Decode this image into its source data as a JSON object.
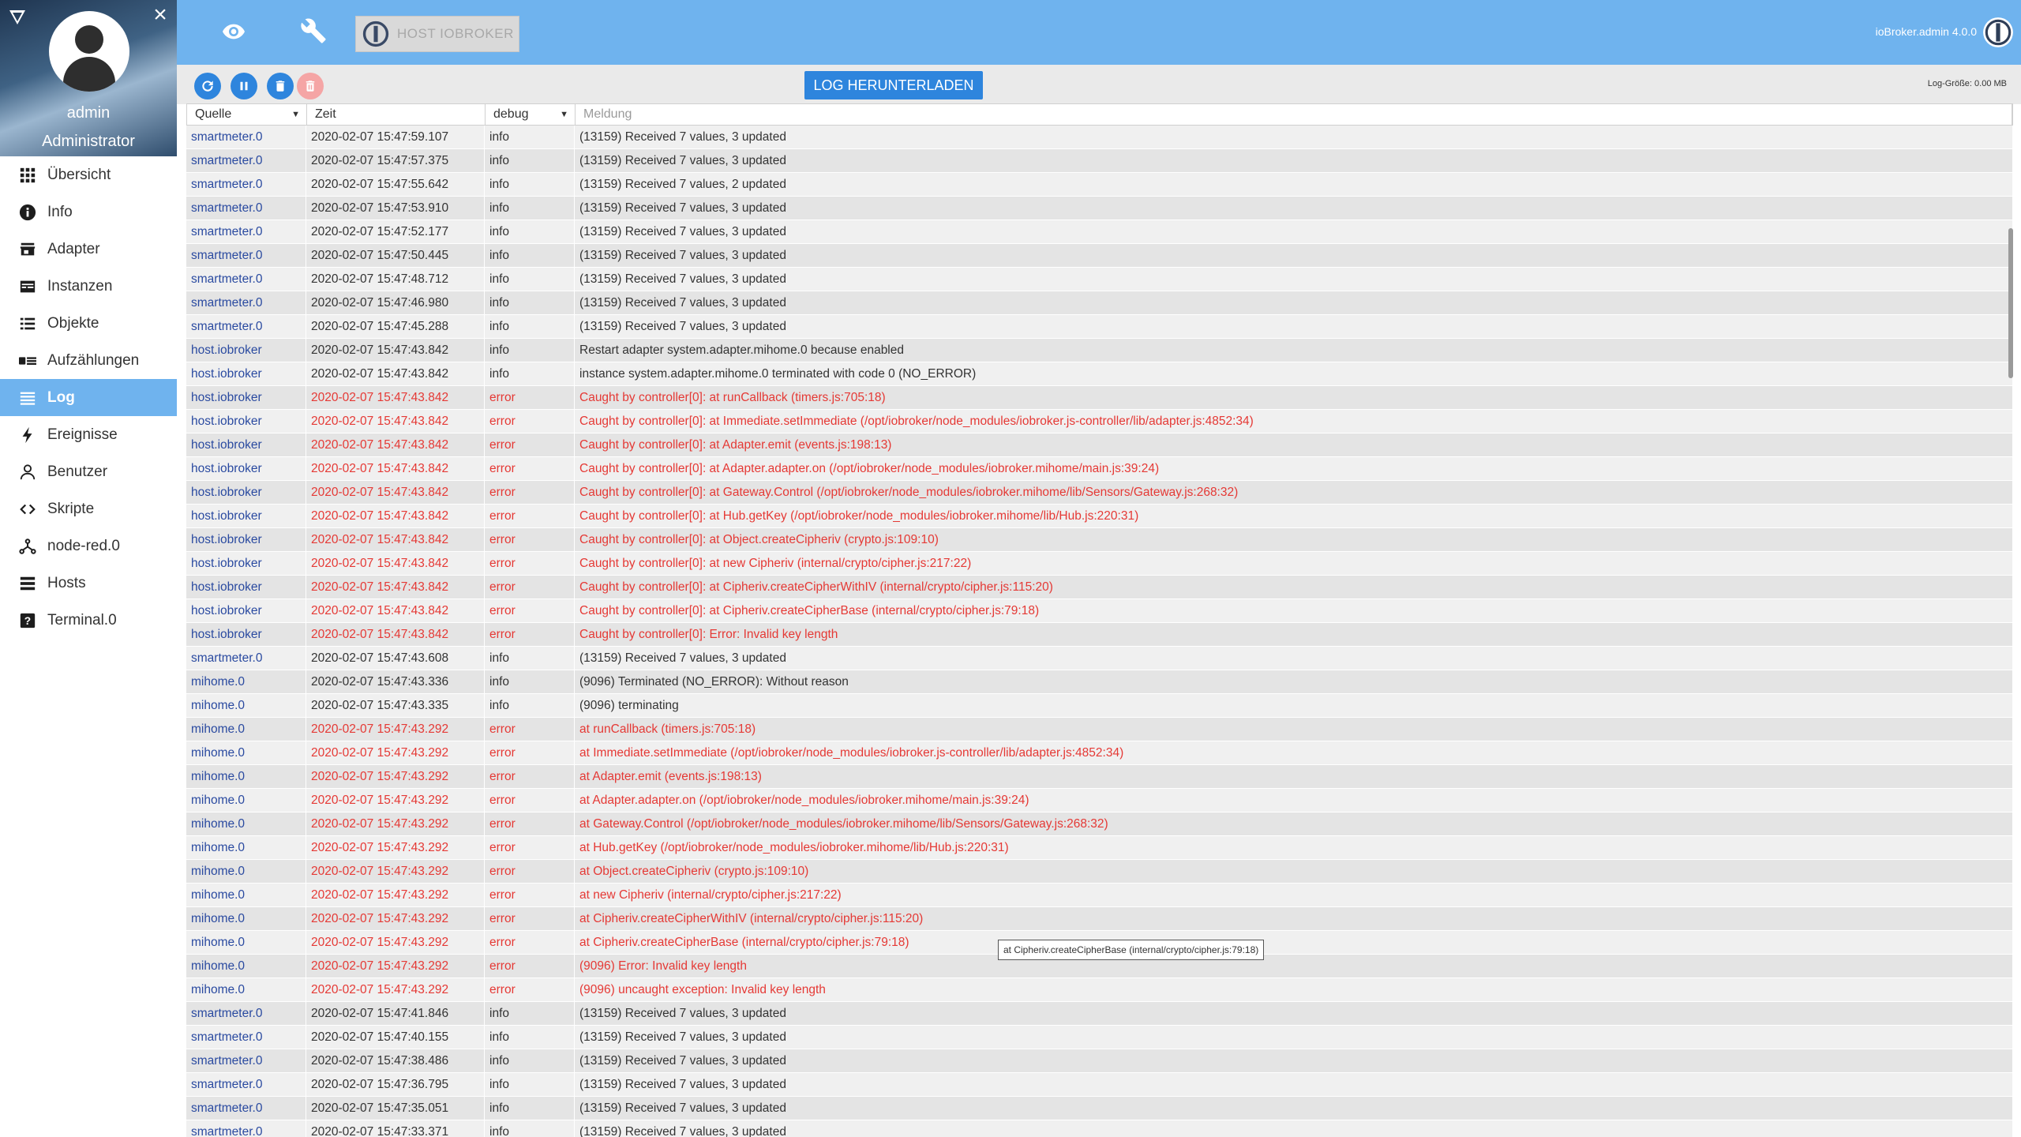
{
  "user": {
    "name": "admin",
    "role": "Administrator"
  },
  "nav": [
    {
      "label": "Übersicht",
      "icon": "grid-icon"
    },
    {
      "label": "Info",
      "icon": "info-icon"
    },
    {
      "label": "Adapter",
      "icon": "store-icon"
    },
    {
      "label": "Instanzen",
      "icon": "instances-icon"
    },
    {
      "label": "Objekte",
      "icon": "list-icon"
    },
    {
      "label": "Aufzählungen",
      "icon": "enum-icon"
    },
    {
      "label": "Log",
      "icon": "log-icon",
      "active": true
    },
    {
      "label": "Ereignisse",
      "icon": "lightning-icon"
    },
    {
      "label": "Benutzer",
      "icon": "user-icon"
    },
    {
      "label": "Skripte",
      "icon": "code-icon"
    },
    {
      "label": "node-red.0",
      "icon": "node-red-icon"
    },
    {
      "label": "Hosts",
      "icon": "hosts-icon"
    },
    {
      "label": "Terminal.0",
      "icon": "terminal-icon"
    }
  ],
  "topbar": {
    "host_tab": "HOST IOBROKER",
    "version": "ioBroker.admin 4.0.0"
  },
  "toolbar": {
    "download": "LOG HERUNTERLADEN",
    "log_size": "Log-Größe: 0.00 MB"
  },
  "table": {
    "headers": {
      "source": "Quelle",
      "time": "Zeit",
      "severity": "debug",
      "message_placeholder": "Meldung"
    },
    "rows": [
      {
        "src": "smartmeter.0",
        "time": "2020-02-07 15:47:59.107",
        "sev": "info",
        "msg": "(13159) Received 7 values, 3 updated"
      },
      {
        "src": "smartmeter.0",
        "time": "2020-02-07 15:47:57.375",
        "sev": "info",
        "msg": "(13159) Received 7 values, 3 updated"
      },
      {
        "src": "smartmeter.0",
        "time": "2020-02-07 15:47:55.642",
        "sev": "info",
        "msg": "(13159) Received 7 values, 2 updated"
      },
      {
        "src": "smartmeter.0",
        "time": "2020-02-07 15:47:53.910",
        "sev": "info",
        "msg": "(13159) Received 7 values, 3 updated"
      },
      {
        "src": "smartmeter.0",
        "time": "2020-02-07 15:47:52.177",
        "sev": "info",
        "msg": "(13159) Received 7 values, 3 updated"
      },
      {
        "src": "smartmeter.0",
        "time": "2020-02-07 15:47:50.445",
        "sev": "info",
        "msg": "(13159) Received 7 values, 3 updated"
      },
      {
        "src": "smartmeter.0",
        "time": "2020-02-07 15:47:48.712",
        "sev": "info",
        "msg": "(13159) Received 7 values, 3 updated"
      },
      {
        "src": "smartmeter.0",
        "time": "2020-02-07 15:47:46.980",
        "sev": "info",
        "msg": "(13159) Received 7 values, 3 updated"
      },
      {
        "src": "smartmeter.0",
        "time": "2020-02-07 15:47:45.288",
        "sev": "info",
        "msg": "(13159) Received 7 values, 3 updated"
      },
      {
        "src": "host.iobroker",
        "time": "2020-02-07 15:47:43.842",
        "sev": "info",
        "msg": "Restart adapter system.adapter.mihome.0 because enabled"
      },
      {
        "src": "host.iobroker",
        "time": "2020-02-07 15:47:43.842",
        "sev": "info",
        "msg": "instance system.adapter.mihome.0 terminated with code 0 (NO_ERROR)"
      },
      {
        "src": "host.iobroker",
        "time": "2020-02-07 15:47:43.842",
        "sev": "error",
        "msg": "Caught by controller[0]: at runCallback (timers.js:705:18)"
      },
      {
        "src": "host.iobroker",
        "time": "2020-02-07 15:47:43.842",
        "sev": "error",
        "msg": "Caught by controller[0]: at Immediate.setImmediate (/opt/iobroker/node_modules/iobroker.js-controller/lib/adapter.js:4852:34)"
      },
      {
        "src": "host.iobroker",
        "time": "2020-02-07 15:47:43.842",
        "sev": "error",
        "msg": "Caught by controller[0]: at Adapter.emit (events.js:198:13)"
      },
      {
        "src": "host.iobroker",
        "time": "2020-02-07 15:47:43.842",
        "sev": "error",
        "msg": "Caught by controller[0]: at Adapter.adapter.on (/opt/iobroker/node_modules/iobroker.mihome/main.js:39:24)"
      },
      {
        "src": "host.iobroker",
        "time": "2020-02-07 15:47:43.842",
        "sev": "error",
        "msg": "Caught by controller[0]: at Gateway.Control (/opt/iobroker/node_modules/iobroker.mihome/lib/Sensors/Gateway.js:268:32)"
      },
      {
        "src": "host.iobroker",
        "time": "2020-02-07 15:47:43.842",
        "sev": "error",
        "msg": "Caught by controller[0]: at Hub.getKey (/opt/iobroker/node_modules/iobroker.mihome/lib/Hub.js:220:31)"
      },
      {
        "src": "host.iobroker",
        "time": "2020-02-07 15:47:43.842",
        "sev": "error",
        "msg": "Caught by controller[0]: at Object.createCipheriv (crypto.js:109:10)"
      },
      {
        "src": "host.iobroker",
        "time": "2020-02-07 15:47:43.842",
        "sev": "error",
        "msg": "Caught by controller[0]: at new Cipheriv (internal/crypto/cipher.js:217:22)"
      },
      {
        "src": "host.iobroker",
        "time": "2020-02-07 15:47:43.842",
        "sev": "error",
        "msg": "Caught by controller[0]: at Cipheriv.createCipherWithIV (internal/crypto/cipher.js:115:20)"
      },
      {
        "src": "host.iobroker",
        "time": "2020-02-07 15:47:43.842",
        "sev": "error",
        "msg": "Caught by controller[0]: at Cipheriv.createCipherBase (internal/crypto/cipher.js:79:18)"
      },
      {
        "src": "host.iobroker",
        "time": "2020-02-07 15:47:43.842",
        "sev": "error",
        "msg": "Caught by controller[0]: Error: Invalid key length"
      },
      {
        "src": "smartmeter.0",
        "time": "2020-02-07 15:47:43.608",
        "sev": "info",
        "msg": "(13159) Received 7 values, 3 updated"
      },
      {
        "src": "mihome.0",
        "time": "2020-02-07 15:47:43.336",
        "sev": "info",
        "msg": "(9096) Terminated (NO_ERROR): Without reason"
      },
      {
        "src": "mihome.0",
        "time": "2020-02-07 15:47:43.335",
        "sev": "info",
        "msg": "(9096) terminating"
      },
      {
        "src": "mihome.0",
        "time": "2020-02-07 15:47:43.292",
        "sev": "error",
        "msg": "at runCallback (timers.js:705:18)"
      },
      {
        "src": "mihome.0",
        "time": "2020-02-07 15:47:43.292",
        "sev": "error",
        "msg": "at Immediate.setImmediate (/opt/iobroker/node_modules/iobroker.js-controller/lib/adapter.js:4852:34)"
      },
      {
        "src": "mihome.0",
        "time": "2020-02-07 15:47:43.292",
        "sev": "error",
        "msg": "at Adapter.emit (events.js:198:13)"
      },
      {
        "src": "mihome.0",
        "time": "2020-02-07 15:47:43.292",
        "sev": "error",
        "msg": "at Adapter.adapter.on (/opt/iobroker/node_modules/iobroker.mihome/main.js:39:24)"
      },
      {
        "src": "mihome.0",
        "time": "2020-02-07 15:47:43.292",
        "sev": "error",
        "msg": "at Gateway.Control (/opt/iobroker/node_modules/iobroker.mihome/lib/Sensors/Gateway.js:268:32)"
      },
      {
        "src": "mihome.0",
        "time": "2020-02-07 15:47:43.292",
        "sev": "error",
        "msg": "at Hub.getKey (/opt/iobroker/node_modules/iobroker.mihome/lib/Hub.js:220:31)"
      },
      {
        "src": "mihome.0",
        "time": "2020-02-07 15:47:43.292",
        "sev": "error",
        "msg": "at Object.createCipheriv (crypto.js:109:10)"
      },
      {
        "src": "mihome.0",
        "time": "2020-02-07 15:47:43.292",
        "sev": "error",
        "msg": "at new Cipheriv (internal/crypto/cipher.js:217:22)"
      },
      {
        "src": "mihome.0",
        "time": "2020-02-07 15:47:43.292",
        "sev": "error",
        "msg": "at Cipheriv.createCipherWithIV (internal/crypto/cipher.js:115:20)"
      },
      {
        "src": "mihome.0",
        "time": "2020-02-07 15:47:43.292",
        "sev": "error",
        "msg": "at Cipheriv.createCipherBase (internal/crypto/cipher.js:79:18)"
      },
      {
        "src": "mihome.0",
        "time": "2020-02-07 15:47:43.292",
        "sev": "error",
        "msg": "(9096) Error: Invalid key length"
      },
      {
        "src": "mihome.0",
        "time": "2020-02-07 15:47:43.292",
        "sev": "error",
        "msg": "(9096) uncaught exception: Invalid key length"
      },
      {
        "src": "smartmeter.0",
        "time": "2020-02-07 15:47:41.846",
        "sev": "info",
        "msg": "(13159) Received 7 values, 3 updated"
      },
      {
        "src": "smartmeter.0",
        "time": "2020-02-07 15:47:40.155",
        "sev": "info",
        "msg": "(13159) Received 7 values, 3 updated"
      },
      {
        "src": "smartmeter.0",
        "time": "2020-02-07 15:47:38.486",
        "sev": "info",
        "msg": "(13159) Received 7 values, 3 updated"
      },
      {
        "src": "smartmeter.0",
        "time": "2020-02-07 15:47:36.795",
        "sev": "info",
        "msg": "(13159) Received 7 values, 3 updated"
      },
      {
        "src": "smartmeter.0",
        "time": "2020-02-07 15:47:35.051",
        "sev": "info",
        "msg": "(13159) Received 7 values, 3 updated"
      },
      {
        "src": "smartmeter.0",
        "time": "2020-02-07 15:47:33.371",
        "sev": "info",
        "msg": "(13159) Received 7 values, 3 updated"
      }
    ]
  },
  "tooltip": "at Cipheriv.createCipherBase (internal/crypto/cipher.js:79:18)",
  "colors": {
    "accent": "#6fb3ee",
    "button": "#2e85dd",
    "error": "#e53935",
    "source": "#2a4aa0"
  }
}
